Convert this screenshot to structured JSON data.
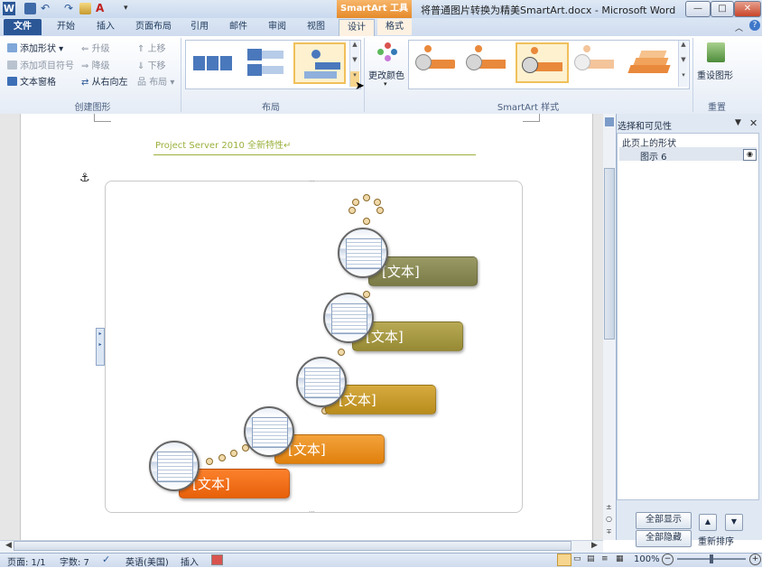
{
  "window": {
    "app_icon_letter": "W",
    "contextual_header": "SmartArt 工具",
    "document_title": "将普通图片转换为精美SmartArt.docx - Microsoft Word",
    "controls": {
      "minimize": "—",
      "maximize": "□",
      "close": "✕"
    }
  },
  "tabs": [
    {
      "label": "文件"
    },
    {
      "label": "开始"
    },
    {
      "label": "插入"
    },
    {
      "label": "页面布局"
    },
    {
      "label": "引用"
    },
    {
      "label": "邮件"
    },
    {
      "label": "审阅"
    },
    {
      "label": "视图"
    },
    {
      "label": "设计"
    },
    {
      "label": "格式"
    }
  ],
  "ribbon": {
    "create_group": {
      "label": "创建图形",
      "add_shape": "添加形状 ▾",
      "add_bullet": "添加项目符号",
      "text_pane": "文本窗格",
      "promote": "升级",
      "demote": "降级",
      "right_to_left": "从右向左",
      "move_up": "上移",
      "move_down": "下移",
      "layout": "布局 ▾"
    },
    "layout_group": {
      "label": "布局"
    },
    "styles_group": {
      "label": "SmartArt 样式",
      "change_colors": "更改颜色"
    },
    "reset_group": {
      "label": "重置",
      "reset_graphic": "重设图形"
    }
  },
  "document": {
    "heading": "Project Server 2010 全新特性↵",
    "smartart_items": [
      {
        "text": "[文本]",
        "color": "#8a8a56"
      },
      {
        "text": "[文本]",
        "color": "#a89b45"
      },
      {
        "text": "[文本]",
        "color": "#c9a030"
      },
      {
        "text": "[文本]",
        "color": "#ec9322"
      },
      {
        "text": "[文本]",
        "color": "#f26f12"
      }
    ]
  },
  "pane": {
    "title": "选择和可见性",
    "subtitle": "此页上的形状",
    "shape_name": "图示 6",
    "show_all": "全部显示",
    "hide_all": "全部隐藏",
    "reorder": "重新排序"
  },
  "status": {
    "page": "页面: 1/1",
    "word_count": "字数: 7",
    "language": "英语(美国)",
    "mode": "插入",
    "zoom": "100%"
  },
  "colors": {
    "file_tab": "#2b5797",
    "context_orange": "#e58a2a",
    "heading_green": "#9bb13d"
  }
}
